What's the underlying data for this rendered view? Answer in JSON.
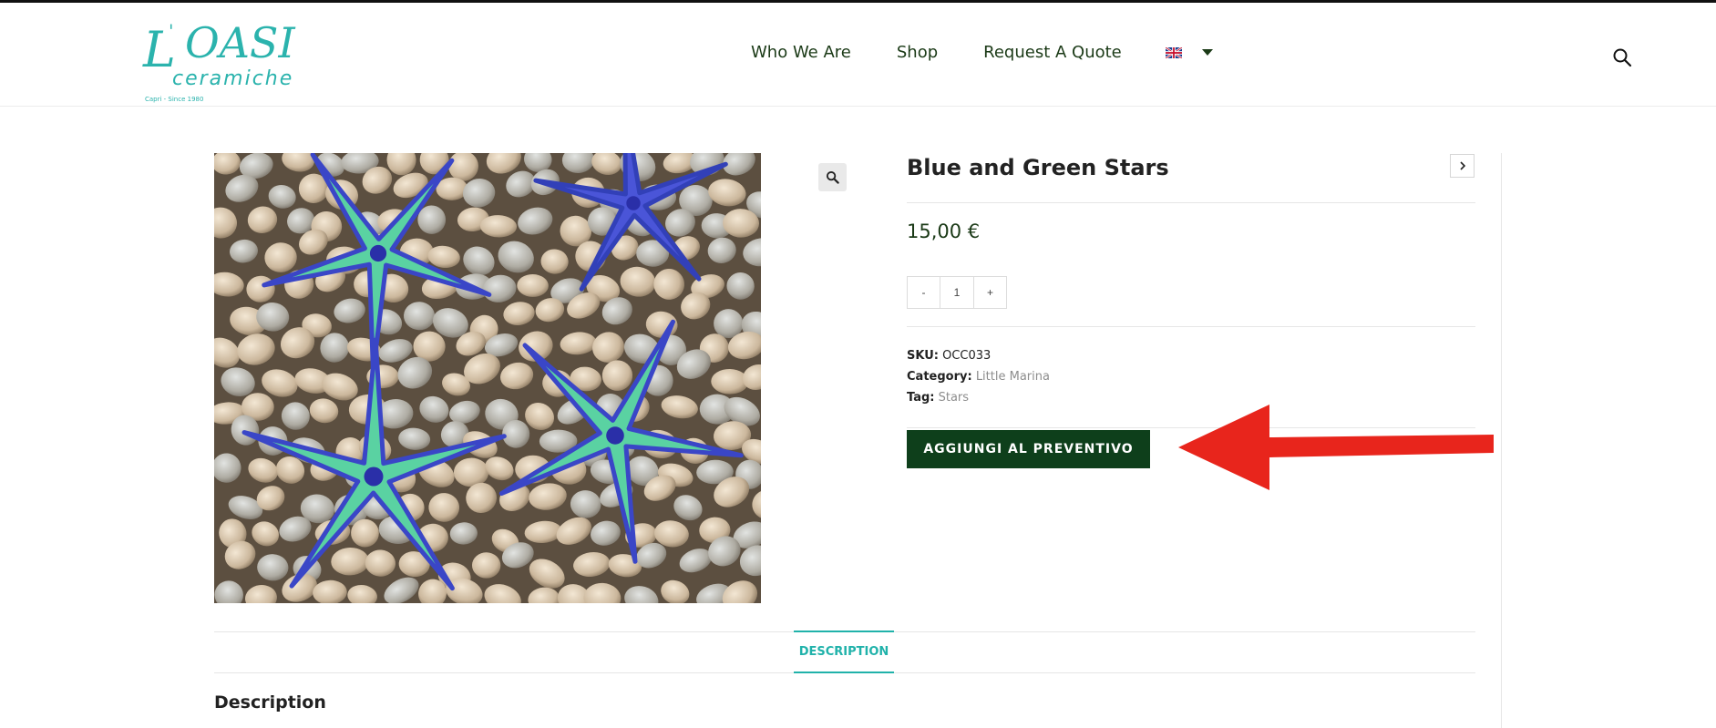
{
  "header": {
    "logo_text": "L'OASI ceramiche",
    "logo_tagline": "Capri - Since 1980",
    "nav": [
      "Who We Are",
      "Shop",
      "Request A Quote"
    ],
    "language_flag": "uk-flag-icon"
  },
  "product": {
    "title": "Blue and Green Stars",
    "price": "15,00 €",
    "quantity": {
      "minus": "-",
      "value": "1",
      "plus": "+"
    },
    "meta": {
      "sku_label": "SKU:",
      "sku_value": "OCC033",
      "category_label": "Category:",
      "category_value": "Little Marina",
      "tag_label": "Tag:",
      "tag_value": "Stars"
    },
    "add_to_quote_label": "AGGIUNGI AL PREVENTIVO"
  },
  "tabs": [
    "DESCRIPTION"
  ],
  "description_heading": "Description",
  "colors": {
    "brand_teal": "#20b2aa",
    "dark_green": "#0e3f1b",
    "nav_text": "#1b3a17",
    "annotation_red": "#e8251c"
  },
  "icons": {
    "search": "search-icon",
    "zoom": "magnifier-icon",
    "next": "chevron-right-icon",
    "dropdown": "caret-down-icon"
  }
}
